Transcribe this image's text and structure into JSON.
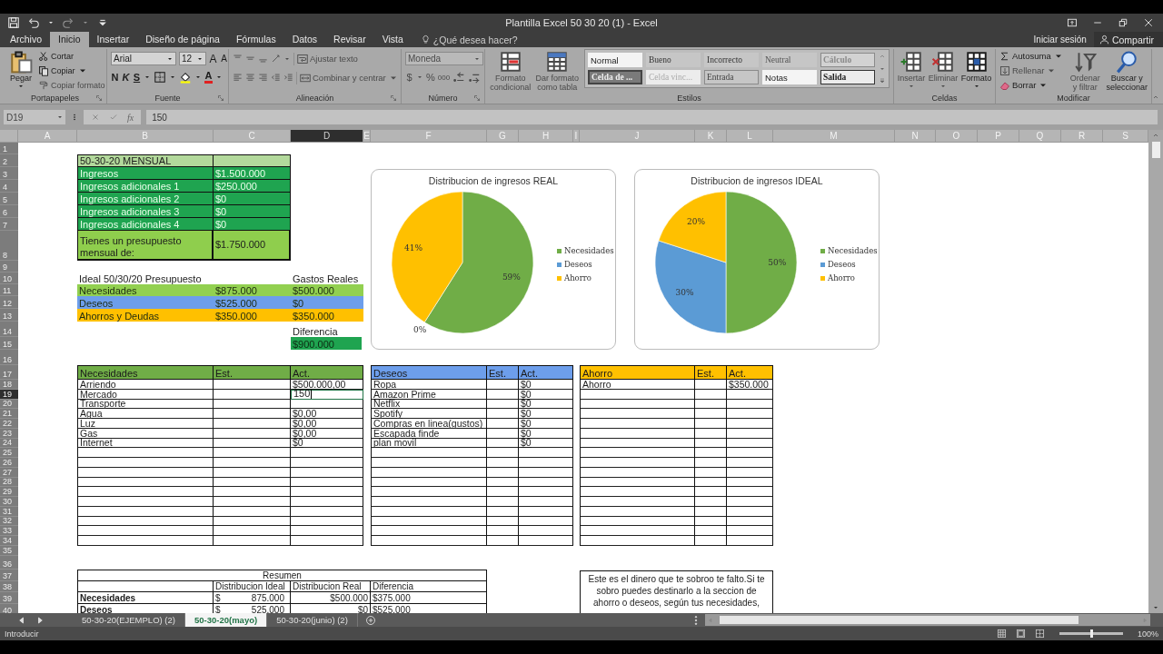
{
  "window": {
    "title": "Plantilla Excel 50 30 20 (1) - Excel"
  },
  "menu_tabs": [
    {
      "label": "Archivo",
      "selected": false
    },
    {
      "label": "Inicio",
      "selected": true
    },
    {
      "label": "Insertar",
      "selected": false
    },
    {
      "label": "Diseño de página",
      "selected": false
    },
    {
      "label": "Fórmulas",
      "selected": false
    },
    {
      "label": "Datos",
      "selected": false
    },
    {
      "label": "Revisar",
      "selected": false
    },
    {
      "label": "Vista",
      "selected": false
    }
  ],
  "tell_me": {
    "placeholder": "¿Qué desea hacer?"
  },
  "account": {
    "sign_in": "Iniciar sesión",
    "share": "Compartir"
  },
  "ribbon": {
    "clipboard": {
      "label": "Portapapeles",
      "paste": "Pegar",
      "cut": "Cortar",
      "copy": "Copiar",
      "format_painter": {
        "label": "Copiar formato",
        "disabled": true
      }
    },
    "font": {
      "label": "Fuente",
      "font_name": "Arial",
      "font_size": "12",
      "grow": "A",
      "shrink": "A",
      "bold": "N",
      "italic": "K",
      "underline": "S",
      "font_color": "A"
    },
    "alignment": {
      "label": "Alineación",
      "disabled": true,
      "wrap_text": "Ajustar texto",
      "merge": "Combinar y centrar"
    },
    "number": {
      "label": "Número",
      "disabled": true,
      "format": "Moneda",
      "currency": "$",
      "percent": "%",
      "thousands": "000"
    },
    "styles": {
      "label": "Estilos",
      "conditional": {
        "label": "Formato condicional",
        "disabled": true
      },
      "as_table": {
        "label": "Dar formato como tabla",
        "disabled": true
      },
      "gallery": [
        {
          "label": "Normal",
          "kind": "normal"
        },
        {
          "label": "Bueno",
          "kind": "good"
        },
        {
          "label": "Incorrecto",
          "kind": "bad"
        },
        {
          "label": "Neutral",
          "kind": "neutral"
        },
        {
          "label": "Cálculo",
          "kind": "calc"
        },
        {
          "label": "Celda de ...",
          "kind": "check"
        },
        {
          "label": "Celda vinc...",
          "kind": "linked"
        },
        {
          "label": "Entrada",
          "kind": "input"
        },
        {
          "label": "Notas",
          "kind": "note"
        },
        {
          "label": "Salida",
          "kind": "output"
        }
      ]
    },
    "cells": {
      "label": "Celdas",
      "insert": {
        "label": "Insertar",
        "disabled": true
      },
      "delete": {
        "label": "Eliminar",
        "disabled": true
      },
      "format": {
        "label": "Formato",
        "disabled": false
      }
    },
    "editing": {
      "label": "Modificar",
      "autosum": {
        "label": "Autosuma",
        "disabled": false
      },
      "fill": {
        "label": "Rellenar",
        "disabled": true
      },
      "clear": {
        "label": "Borrar",
        "disabled": false
      },
      "sort": {
        "label": "Ordenar y filtrar",
        "disabled": true
      },
      "find": {
        "label": "Buscar y seleccionar",
        "disabled": false
      }
    }
  },
  "formula_bar": {
    "name_box": "D19",
    "function_label": "fx",
    "formula": "150"
  },
  "column_headers": [
    {
      "label": "A",
      "selected": false
    },
    {
      "label": "B",
      "selected": false
    },
    {
      "label": "C",
      "selected": false
    },
    {
      "label": "D",
      "selected": true
    },
    {
      "label": "E",
      "selected": false
    },
    {
      "label": "F",
      "selected": false
    },
    {
      "label": "G",
      "selected": false
    },
    {
      "label": "H",
      "selected": false
    },
    {
      "label": "I",
      "selected": false
    },
    {
      "label": "J",
      "selected": false
    },
    {
      "label": "K",
      "selected": false
    },
    {
      "label": "L",
      "selected": false
    },
    {
      "label": "M",
      "selected": false
    },
    {
      "label": "N",
      "selected": false
    },
    {
      "label": "O",
      "selected": false
    },
    {
      "label": "P",
      "selected": false
    },
    {
      "label": "Q",
      "selected": false
    },
    {
      "label": "R",
      "selected": false
    },
    {
      "label": "S",
      "selected": false
    }
  ],
  "row_headers": [
    {
      "label": "1",
      "selected": false
    },
    {
      "label": "2",
      "selected": false
    },
    {
      "label": "3",
      "selected": false
    },
    {
      "label": "4",
      "selected": false
    },
    {
      "label": "5",
      "selected": false
    },
    {
      "label": "6",
      "selected": false
    },
    {
      "label": "7",
      "selected": false
    },
    {
      "label": "8",
      "selected": false
    },
    {
      "label": "9",
      "selected": false
    },
    {
      "label": "10",
      "selected": false
    },
    {
      "label": "11",
      "selected": false
    },
    {
      "label": "12",
      "selected": false
    },
    {
      "label": "13",
      "selected": false
    },
    {
      "label": "14",
      "selected": false
    },
    {
      "label": "15",
      "selected": false
    },
    {
      "label": "16",
      "selected": false
    },
    {
      "label": "17",
      "selected": false
    },
    {
      "label": "18",
      "selected": false
    },
    {
      "label": "19",
      "selected": true
    },
    {
      "label": "20",
      "selected": false
    },
    {
      "label": "21",
      "selected": false
    },
    {
      "label": "22",
      "selected": false
    },
    {
      "label": "23",
      "selected": false
    },
    {
      "label": "24",
      "selected": false
    },
    {
      "label": "25",
      "selected": false
    },
    {
      "label": "26",
      "selected": false
    },
    {
      "label": "27",
      "selected": false
    },
    {
      "label": "28",
      "selected": false
    },
    {
      "label": "29",
      "selected": false
    },
    {
      "label": "30",
      "selected": false
    },
    {
      "label": "31",
      "selected": false
    },
    {
      "label": "32",
      "selected": false
    },
    {
      "label": "33",
      "selected": false
    },
    {
      "label": "34",
      "selected": false
    },
    {
      "label": "35",
      "selected": false
    },
    {
      "label": "36",
      "selected": false
    },
    {
      "label": "37",
      "selected": false
    },
    {
      "label": "38",
      "selected": false
    },
    {
      "label": "39",
      "selected": false
    },
    {
      "label": "40",
      "selected": false
    }
  ],
  "income_table": {
    "title": "50-30-20 MENSUAL",
    "rows": [
      {
        "label": "Ingresos",
        "value": "$1.500.000"
      },
      {
        "label": "Ingresos adicionales 1",
        "value": "$250.000"
      },
      {
        "label": "Ingresos adicionales 2",
        "value": "$0"
      },
      {
        "label": "Ingresos adicionales 3",
        "value": "$0"
      },
      {
        "label": "Ingresos adicionales 4",
        "value": "$0"
      }
    ],
    "total": {
      "label": "Tienes un presupuesto mensual de:",
      "value": "$1.750.000"
    }
  },
  "budget": {
    "heading": "Ideal 50/30/20 Presupuesto",
    "actual_heading": "Gastos Reales",
    "rows": [
      {
        "label": "Necesidades",
        "ideal": "$875.000",
        "actual": "$500.000",
        "color": "#92d050"
      },
      {
        "label": "Deseos",
        "ideal": "$525.000",
        "actual": "$0",
        "color": "#6d9eeb"
      },
      {
        "label": "Ahorros y Deudas",
        "ideal": "$350.000",
        "actual": "$350.000",
        "color": "#ffc000"
      }
    ],
    "difference_label": "Diferencia",
    "difference": "$900.000"
  },
  "charts": [
    {
      "chart_data": {
        "type": "pie",
        "title": "Distribucion de ingresos REAL",
        "categories": [
          "Necesidades",
          "Deseos",
          "Ahorro"
        ],
        "values": [
          59,
          0,
          41
        ],
        "value_labels": [
          "59%",
          "0%",
          "41%"
        ],
        "colors": [
          "#70ad47",
          "#5b9bd5",
          "#ffc000"
        ],
        "legend": "right"
      }
    },
    {
      "chart_data": {
        "type": "pie",
        "title": "Distribucion de ingresos IDEAL",
        "categories": [
          "Necesidades",
          "Deseos",
          "Ahorro"
        ],
        "values": [
          50,
          30,
          20
        ],
        "value_labels": [
          "50%",
          "30%",
          "20%"
        ],
        "colors": [
          "#70ad47",
          "#5b9bd5",
          "#ffc000"
        ],
        "legend": "right"
      }
    }
  ],
  "expense_tables": [
    {
      "title": "Necesidades",
      "est": "Est.",
      "act": "Act.",
      "color": "#70ad47",
      "rows": [
        {
          "item": "Arriendo",
          "act": "$500.000,00",
          "editing": false
        },
        {
          "item": "Mercado",
          "act": "150",
          "editing": true
        },
        {
          "item": "Transporte",
          "editing": false
        },
        {
          "item": "Agua",
          "act": "$0,00",
          "editing": false
        },
        {
          "item": "Luz",
          "act": "$0,00",
          "editing": false
        },
        {
          "item": "Gas",
          "act": "$0,00",
          "editing": false
        },
        {
          "item": "Internet",
          "act": "$0",
          "editing": false
        }
      ]
    },
    {
      "title": "Deseos",
      "est": "Est.",
      "act": "Act.",
      "color": "#6d9eeb",
      "rows": [
        {
          "item": "Ropa",
          "act": "$0",
          "editing": false
        },
        {
          "item": "Amazon Prime",
          "act": "$0",
          "editing": false
        },
        {
          "item": "Netflix",
          "act": "$0",
          "editing": false
        },
        {
          "item": "Spotify",
          "act": "$0",
          "editing": false
        },
        {
          "item": "Compras en linea(gustos)",
          "act": "$0",
          "editing": false
        },
        {
          "item": "Escapada finde",
          "act": "$0",
          "editing": false
        },
        {
          "item": "plan movil",
          "act": "$0",
          "editing": false
        }
      ]
    },
    {
      "title": "Ahorro",
      "est": "Est.",
      "act": "Act.",
      "color": "#ffc000",
      "rows": [
        {
          "item": "Ahorro",
          "act": "$350.000",
          "editing": false
        }
      ]
    }
  ],
  "summary": {
    "title": "Resumen",
    "columns": [
      "Distribucion Ideal",
      "Distribucion Real",
      "Diferencia"
    ],
    "rows": [
      {
        "label": "Necesidades",
        "currency": "$",
        "ideal": "875.000",
        "real": "$500.000",
        "difference": "$375.000"
      },
      {
        "label": "Deseos",
        "currency": "$",
        "ideal": "525.000",
        "real": "$0",
        "difference": "$525.000"
      }
    ]
  },
  "note": "Este es el dinero que te sobroo te falto.Si te sobro puedes destinarlo a la seccion de ahorro o deseos, según tus necesidades,",
  "sheet_tabs": [
    {
      "label": "50-30-20(EJEMPLO) (2)",
      "selected": false
    },
    {
      "label": "50-30-20(mayo)",
      "selected": true
    },
    {
      "label": "50-30-20(junio) (2)",
      "selected": false
    }
  ],
  "status_bar": {
    "mode": "Introducir",
    "zoom_slider": {
      "level": 0.5
    },
    "zoom": "100%"
  }
}
